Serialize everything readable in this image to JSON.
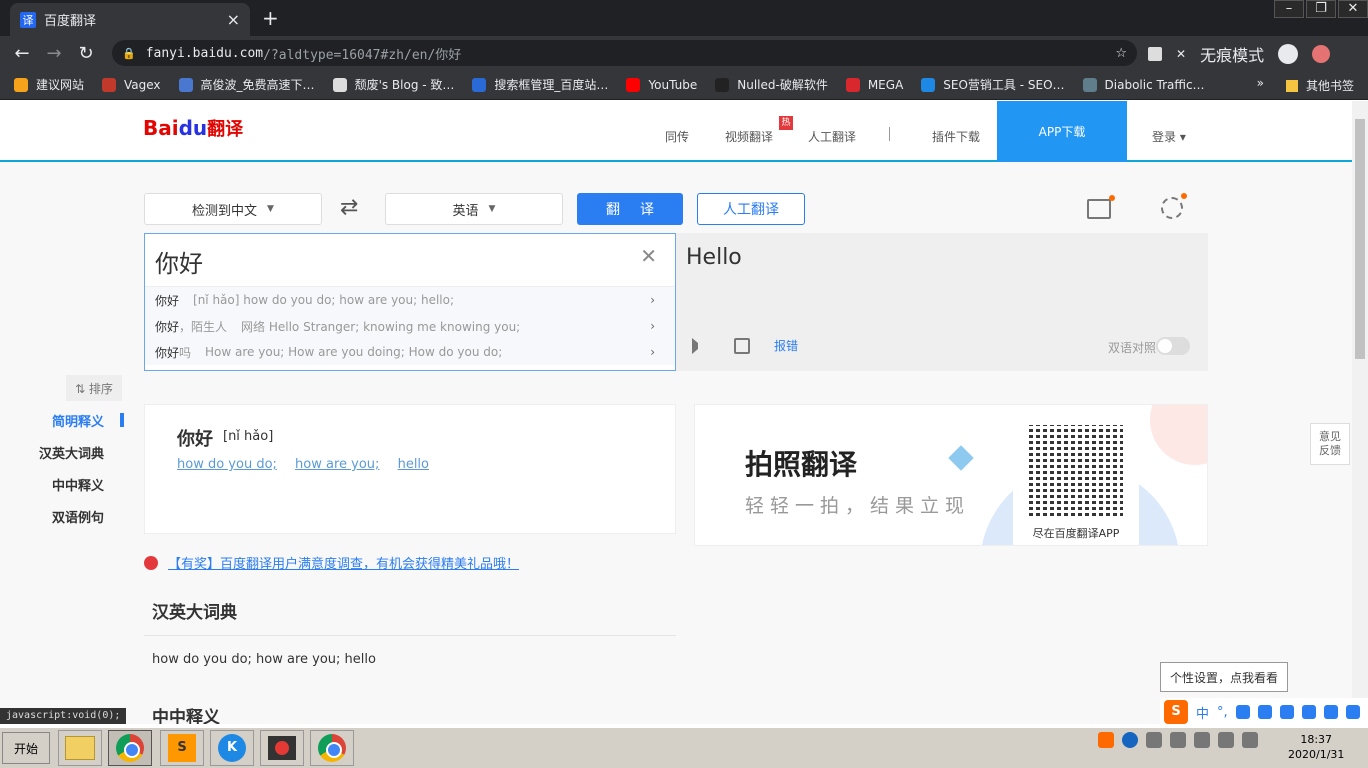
{
  "browser": {
    "tab_title": "百度翻译",
    "tab_favicon": "译",
    "url_host": "fanyi.baidu.com",
    "url_path": "/?aldtype=16047#zh/en/你好",
    "incognito_label": "无痕模式",
    "bookmarks": [
      {
        "label": "建议网站",
        "color": "#f7a21b"
      },
      {
        "label": "Vagex",
        "color": "#c0392b"
      },
      {
        "label": "高俊波_免费高速下…",
        "color": "#4a78d0"
      },
      {
        "label": "颓废's Blog - 致…",
        "color": "#dddddd"
      },
      {
        "label": "搜索框管理_百度站…",
        "color": "#2a6ad6"
      },
      {
        "label": "YouTube",
        "color": "#ff0000"
      },
      {
        "label": "Nulled-破解软件",
        "color": "#222222"
      },
      {
        "label": "MEGA",
        "color": "#d9272e"
      },
      {
        "label": "SEO营销工具 - SEO…",
        "color": "#1e88e5"
      },
      {
        "label": "Diabolic Traffic…",
        "color": "#607d8b"
      }
    ],
    "bookmarks_more": "»",
    "other_bookmarks": "其他书签"
  },
  "header": {
    "logo_bai": "Bai",
    "logo_du": "du",
    "logo_cn": "翻译",
    "nav": [
      "同传",
      "视频翻译",
      "人工翻译",
      "插件下载"
    ],
    "hot_badge": "热",
    "app_download": "APP下载",
    "login": "登录 ▾"
  },
  "translator": {
    "source_lang": "检测到中文",
    "target_lang": "英语",
    "swap_icon": "⇄",
    "translate_btn": "翻译",
    "human_btn": "人工翻译",
    "input_text": "你好",
    "suggestions": [
      {
        "key": "你好",
        "key_gray": "",
        "value": "[nǐ hǎo] how do you do; how are you; hello;"
      },
      {
        "key": "你好",
        "key_gray": "，陌生人",
        "value": "网络 Hello Stranger; knowing me knowing you;"
      },
      {
        "key": "你好",
        "key_gray": "吗",
        "value": "How are you; How are you doing; How do you do;"
      }
    ],
    "output_text": "Hello",
    "report": "报错",
    "bilingual": "双语对照"
  },
  "sidebar": {
    "sort": "⇅ 排序",
    "items": [
      "简明释义",
      "汉英大词典",
      "中中释义",
      "双语例句"
    ]
  },
  "definition": {
    "word": "你好",
    "pinyin": "[nǐ hǎo]",
    "meanings": [
      "how do you do;",
      "how are you;",
      "hello"
    ]
  },
  "ad": {
    "title": "拍照翻译",
    "subtitle": "轻轻一拍，结果立现",
    "qr_caption": "尽在百度翻译APP"
  },
  "survey_text": "【有奖】百度翻译用户满意度调查，有机会获得精美礼品哦！",
  "dict_section": {
    "title": "汉英大词典",
    "definition": "how do you do; how are you; hello"
  },
  "zhzh_section_title": "中中释义",
  "feedback": "意见\n反馈",
  "status_bar": "javascript:void(0);",
  "ime": {
    "tooltip": "个性设置，点我看看",
    "logo": "S",
    "mode": "中"
  },
  "taskbar": {
    "start": "开始",
    "time": "18:37",
    "date": "2020/1/31"
  }
}
